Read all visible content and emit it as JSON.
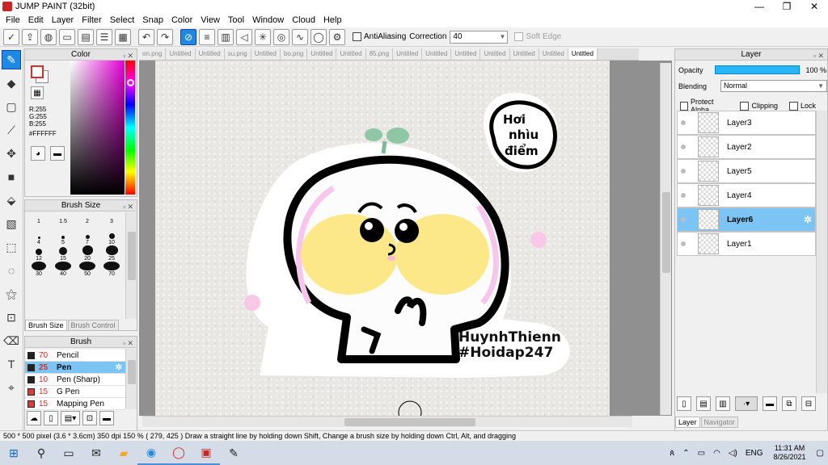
{
  "window": {
    "title": "JUMP PAINT (32bit)",
    "minimize": "—",
    "maximize": "❐",
    "close": "✕"
  },
  "menu": [
    "File",
    "Edit",
    "Layer",
    "Filter",
    "Select",
    "Snap",
    "Color",
    "View",
    "Tool",
    "Window",
    "Cloud",
    "Help"
  ],
  "toolbar": {
    "antialiasing_label": "AntiAliasing",
    "correction_label": "Correction",
    "correction_value": "40",
    "softedge_label": "Soft Edge"
  },
  "color_panel": {
    "title": "Color",
    "r": "R:255",
    "g": "G:255",
    "b": "B:255",
    "hex": "#FFFFFF",
    "fg_color": "#FFFFFF",
    "bg_color": "#FFFFFF"
  },
  "brush_size_panel": {
    "title": "Brush Size",
    "sizes": [
      "1",
      "1.5",
      "2",
      "3",
      "4",
      "5",
      "7",
      "10",
      "12",
      "15",
      "20",
      "25",
      "30",
      "40",
      "50",
      "70"
    ],
    "tabs": [
      "Brush Size",
      "Brush Control"
    ]
  },
  "brush_panel": {
    "title": "Brush",
    "items": [
      {
        "size": "70",
        "name": "Pencil",
        "color": "#222222",
        "selected": false
      },
      {
        "size": "25",
        "name": "Pen",
        "color": "#222222",
        "selected": true
      },
      {
        "size": "10",
        "name": "Pen (Sharp)",
        "color": "#222222",
        "selected": false
      },
      {
        "size": "15",
        "name": "G Pen",
        "color": "#e53935",
        "selected": false
      },
      {
        "size": "15",
        "name": "Mapping Pen",
        "color": "#e53935",
        "selected": false
      }
    ]
  },
  "doc_tabs": [
    "on.png",
    "Untitled",
    "Untitled",
    "su.png",
    "Untitled",
    "bo.png",
    "Untitled",
    "Untitled",
    "85.png",
    "Untitled",
    "Untitled",
    "Untitled",
    "Untitled",
    "Untitled",
    "Untitled",
    "Untitled"
  ],
  "active_doc_tab": 15,
  "artwork": {
    "speech_text": [
      "Hơi",
      "nhìu",
      "điểm"
    ],
    "watermark": [
      "HuynhThienn",
      "#Hoidap247"
    ]
  },
  "layer_panel": {
    "title": "Layer",
    "opacity_label": "Opacity",
    "opacity_value": "100 %",
    "blending_label": "Blending",
    "blending_value": "Normal",
    "protect_alpha": "Protect Alpha",
    "clipping": "Clipping",
    "lock": "Lock",
    "layers": [
      {
        "name": "Layer3",
        "selected": false
      },
      {
        "name": "Layer2",
        "selected": false
      },
      {
        "name": "Layer5",
        "selected": false
      },
      {
        "name": "Layer4",
        "selected": false
      },
      {
        "name": "Layer6",
        "selected": true
      },
      {
        "name": "Layer1",
        "selected": false
      }
    ],
    "tabs": [
      "Layer",
      "Navigator"
    ]
  },
  "status": {
    "size": "500 * 500 pixel",
    "cm": "(3.6 * 3.6cm)",
    "dpi": "350 dpi",
    "zoom": "150 %",
    "coords": "( 279, 425 )",
    "hint": "Draw a straight line by holding down Shift, Change a brush size by holding down Ctrl, Alt, and dragging"
  },
  "taskbar": {
    "language": "ENG",
    "time": "11:31 AM",
    "date": "8/26/2021"
  }
}
